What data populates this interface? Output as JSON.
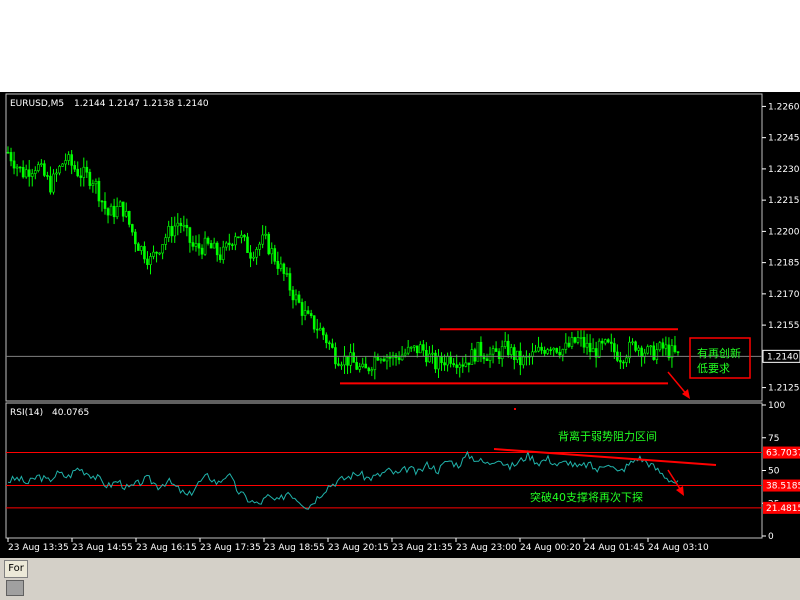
{
  "chart_data": [
    {
      "type": "candlestick",
      "symbol": "EURUSD,M5",
      "ohlc_label": "1.2144 1.2147 1.2138 1.2140",
      "ylim": [
        1.212,
        1.2265
      ],
      "y_ticks": [
        "1.2260",
        "1.2245",
        "1.2230",
        "1.2215",
        "1.2200",
        "1.2185",
        "1.2170",
        "1.2155",
        "1.2125"
      ],
      "y_tick_values": [
        1.226,
        1.2245,
        1.223,
        1.2215,
        1.22,
        1.2185,
        1.217,
        1.2155,
        1.2125
      ],
      "current_price": "1.2140",
      "current_price_value": 1.214,
      "price_path": [
        1.2238,
        1.2228,
        1.2232,
        1.2222,
        1.2235,
        1.2228,
        1.2225,
        1.2208,
        1.2212,
        1.2195,
        1.2186,
        1.2197,
        1.2205,
        1.2192,
        1.2193,
        1.2188,
        1.22,
        1.219,
        1.2196,
        1.2184,
        1.217,
        1.2158,
        1.2152,
        1.214,
        1.2138,
        1.2132,
        1.2142,
        1.2139,
        1.2142,
        1.2144,
        1.2136,
        1.214,
        1.2137,
        1.2143,
        1.214,
        1.2144,
        1.2137,
        1.2141,
        1.2146,
        1.2143,
        1.2148,
        1.2142,
        1.2145,
        1.214,
        1.2146,
        1.2141,
        1.2144,
        1.214
      ],
      "support_line": 1.2127,
      "resistance_line": 1.2153,
      "annotation": "有再创新\n低要求",
      "annotation_lines": [
        "有再创新",
        "低要求"
      ]
    },
    {
      "type": "line",
      "indicator": "RSI(14)",
      "value_label": "40.0765",
      "ylim": [
        0,
        100
      ],
      "y_ticks": [
        "100",
        "75",
        "50",
        "25",
        "0"
      ],
      "y_tick_values": [
        100,
        75,
        50,
        25,
        0
      ],
      "levels": [
        {
          "value": 63.7037,
          "label": "63.7037"
        },
        {
          "value": 38.5185,
          "label": "38.5185"
        },
        {
          "value": 21.4815,
          "label": "21.4815"
        }
      ],
      "rsi_path": [
        42,
        44,
        40,
        46,
        42,
        48,
        45,
        52,
        48,
        44,
        38,
        42,
        36,
        40,
        44,
        38,
        42,
        36,
        30,
        40,
        46,
        40,
        48,
        34,
        28,
        24,
        30,
        26,
        34,
        28,
        22,
        30,
        38,
        42,
        45,
        48,
        44,
        46,
        50,
        47,
        52,
        48,
        55,
        50,
        58,
        54,
        62,
        58,
        55,
        60,
        52,
        56,
        62,
        56,
        59,
        54,
        57,
        52,
        55,
        50,
        57,
        48,
        54,
        60,
        56,
        50,
        44,
        40
      ],
      "annotations": [
        "背离于弱势阻力区间",
        "突破40支撑将再次下探"
      ]
    }
  ],
  "x_axis_labels": [
    "23 Aug 13:35",
    "23 Aug 14:55",
    "23 Aug 16:15",
    "23 Aug 17:35",
    "23 Aug 18:55",
    "23 Aug 20:15",
    "23 Aug 21:35",
    "23 Aug 23:00",
    "24 Aug 00:20",
    "24 Aug 01:45",
    "24 Aug 03:10"
  ],
  "bottom_tab": "For",
  "colors": {
    "background": "#000000",
    "candle": "#00ff00",
    "rsi_line": "#20b2aa",
    "level_line": "#ff0000",
    "annotation_text": "#22ff22",
    "axis_text": "#ffffff"
  }
}
